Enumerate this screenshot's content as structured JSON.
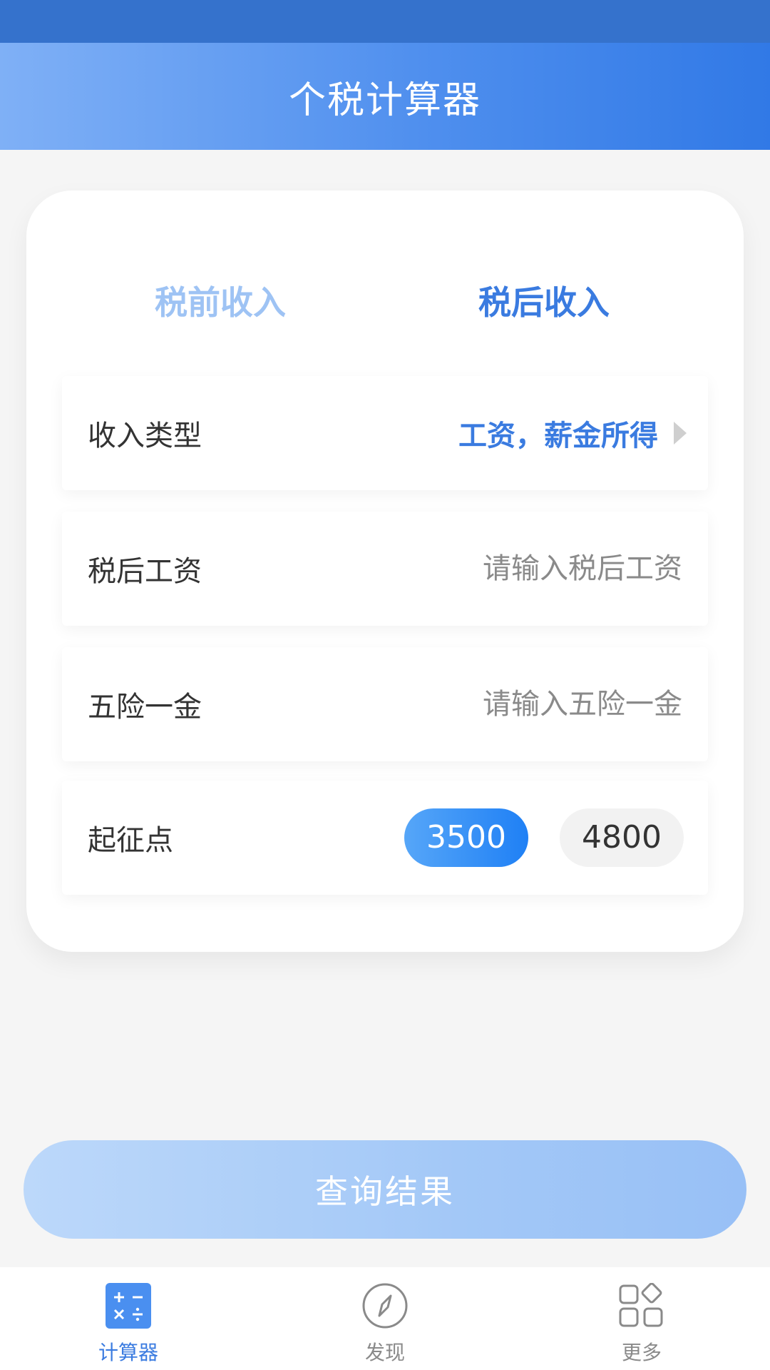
{
  "header": {
    "title": "个税计算器"
  },
  "tabs": {
    "pre_tax": "税前收入",
    "post_tax": "税后收入",
    "active": "post_tax"
  },
  "form": {
    "income_type": {
      "label": "收入类型",
      "value": "工资，薪金所得"
    },
    "after_tax_salary": {
      "label": "税后工资",
      "placeholder": "请输入税后工资"
    },
    "insurance": {
      "label": "五险一金",
      "placeholder": "请输入五险一金"
    },
    "threshold": {
      "label": "起征点",
      "options": [
        "3500",
        "4800"
      ],
      "selected": "3500"
    }
  },
  "actions": {
    "query": "查询结果"
  },
  "bottom_nav": {
    "items": [
      {
        "label": "计算器"
      },
      {
        "label": "发现"
      },
      {
        "label": "更多"
      }
    ]
  },
  "colors": {
    "accent": "#3a7be0",
    "header_start": "#7fb0f6",
    "header_end": "#3179e6",
    "status_bar": "#3572cc"
  },
  "icons": [
    "calculator-icon",
    "compass-icon",
    "apps-grid-icon",
    "chevron-right-icon"
  ]
}
